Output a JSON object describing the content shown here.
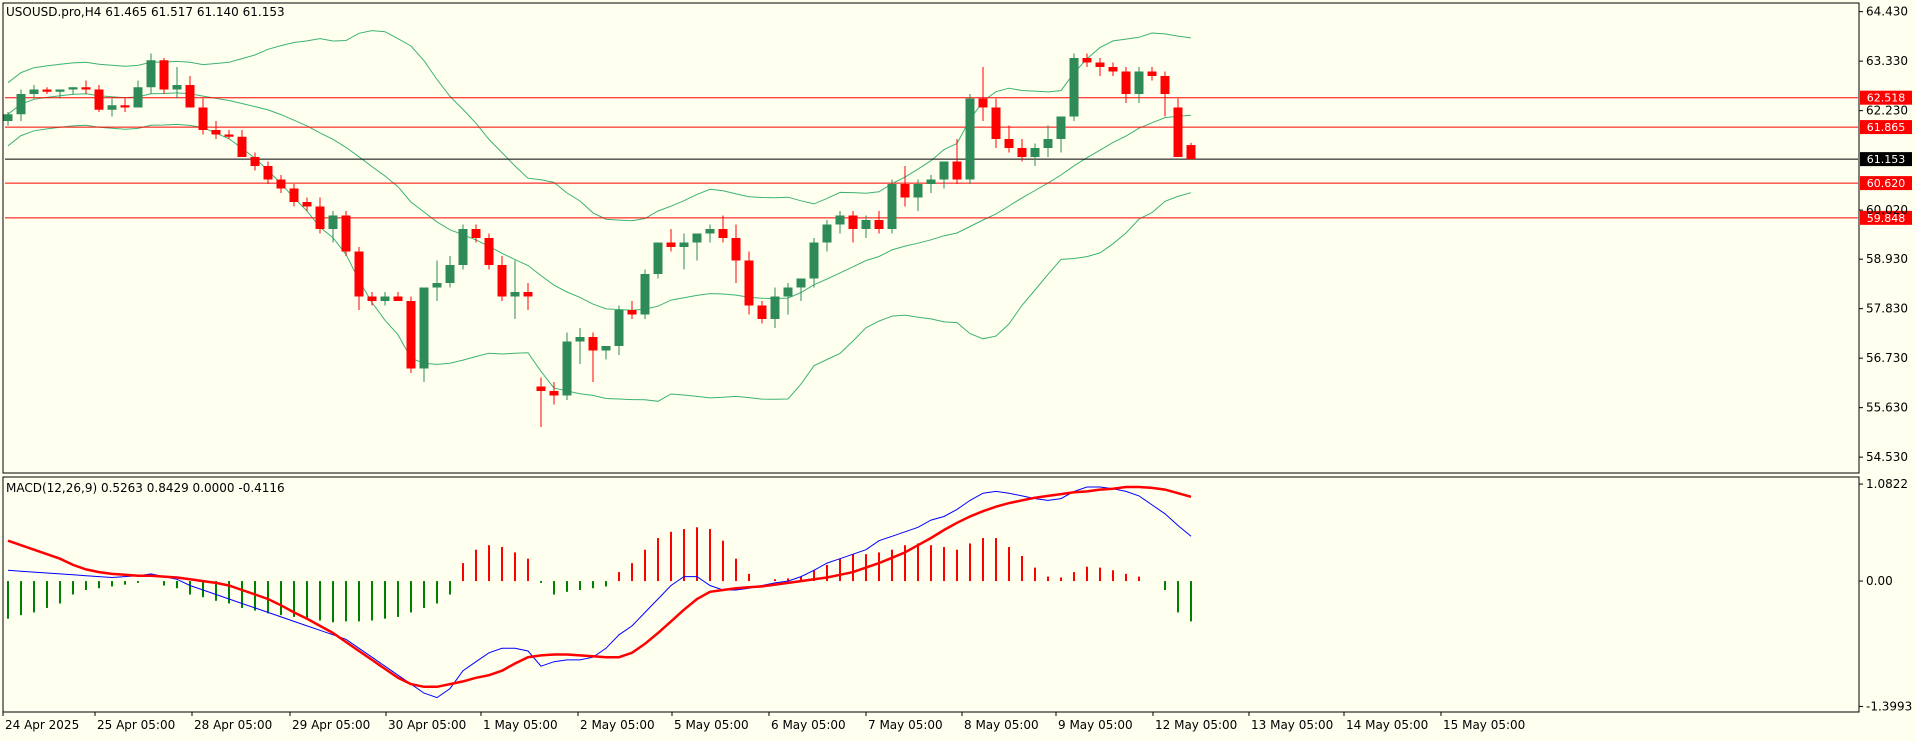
{
  "header": {
    "symbol_info": "USOUSD.pro,H4  61.465 61.517 61.140 61.153",
    "macd_info": "MACD(12,26,9) 0.5263 0.8429 0.0000 -0.4116"
  },
  "colors": {
    "background": "#fffff0",
    "bull": "#2e8b57",
    "bear": "#ff0000",
    "bands": "#3cb371",
    "level_line": "#ff0000",
    "current_line": "#000000",
    "macd_main": "#0000ff",
    "macd_signal": "#ff0000",
    "hist_pos": "#ff0000",
    "hist_neg": "#008000"
  },
  "chart_data": [
    {
      "type": "candlestick",
      "title": "USOUSD.pro,H4",
      "ohlc_last": {
        "open": 61.465,
        "high": 61.517,
        "low": 61.14,
        "close": 61.153
      },
      "ylim": [
        54.2,
        64.6
      ],
      "y_ticks": [
        "64.430",
        "63.330",
        "62.230",
        "60.020",
        "58.930",
        "57.830",
        "56.730",
        "55.630",
        "54.530"
      ],
      "x_ticks": [
        "24 Apr 2025",
        "25 Apr 05:00",
        "28 Apr 05:00",
        "29 Apr 05:00",
        "30 Apr 05:00",
        "1 May 05:00",
        "2 May 05:00",
        "5 May 05:00",
        "6 May 05:00",
        "7 May 05:00",
        "8 May 05:00",
        "9 May 05:00",
        "12 May 05:00",
        "13 May 05:00",
        "14 May 05:00",
        "15 May 05:00"
      ],
      "levels": [
        {
          "label": "62.518",
          "value": 62.518
        },
        {
          "label": "61.865",
          "value": 61.865
        },
        {
          "label": "60.620",
          "value": 60.62
        },
        {
          "label": "59.848",
          "value": 59.848
        }
      ],
      "current_price": {
        "label": "61.153",
        "value": 61.153
      },
      "candles": [
        [
          62.0,
          62.2,
          61.9,
          62.15
        ],
        [
          62.15,
          62.7,
          62.0,
          62.6
        ],
        [
          62.6,
          62.8,
          62.5,
          62.7
        ],
        [
          62.7,
          62.75,
          62.6,
          62.65
        ],
        [
          62.65,
          62.7,
          62.5,
          62.7
        ],
        [
          62.7,
          62.75,
          62.6,
          62.75
        ],
        [
          62.75,
          62.9,
          62.6,
          62.7
        ],
        [
          62.7,
          62.8,
          62.2,
          62.25
        ],
        [
          62.25,
          62.5,
          62.1,
          62.35
        ],
        [
          62.35,
          62.5,
          62.2,
          62.3
        ],
        [
          62.3,
          62.9,
          62.3,
          62.75
        ],
        [
          62.75,
          63.5,
          62.6,
          63.35
        ],
        [
          63.35,
          63.4,
          62.6,
          62.7
        ],
        [
          62.7,
          63.2,
          62.5,
          62.8
        ],
        [
          62.8,
          63.0,
          62.3,
          62.3
        ],
        [
          62.3,
          62.5,
          61.7,
          61.8
        ],
        [
          61.8,
          62.0,
          61.6,
          61.7
        ],
        [
          61.7,
          61.8,
          61.6,
          61.65
        ],
        [
          61.65,
          61.8,
          61.2,
          61.2
        ],
        [
          61.2,
          61.3,
          60.9,
          61.0
        ],
        [
          61.0,
          61.1,
          60.6,
          60.7
        ],
        [
          60.7,
          60.8,
          60.4,
          60.5
        ],
        [
          60.5,
          60.6,
          60.1,
          60.2
        ],
        [
          60.2,
          60.3,
          60.0,
          60.1
        ],
        [
          60.1,
          60.3,
          59.5,
          59.6
        ],
        [
          59.6,
          60.0,
          59.3,
          59.9
        ],
        [
          59.9,
          60.0,
          59.0,
          59.1
        ],
        [
          59.1,
          59.2,
          57.8,
          58.1
        ],
        [
          58.1,
          58.2,
          57.9,
          58.0
        ],
        [
          58.0,
          58.2,
          57.9,
          58.1
        ],
        [
          58.1,
          58.2,
          58.0,
          58.0
        ],
        [
          58.0,
          58.1,
          56.4,
          56.5
        ],
        [
          56.5,
          58.3,
          56.2,
          58.3
        ],
        [
          58.3,
          58.9,
          58.0,
          58.4
        ],
        [
          58.4,
          59.0,
          58.3,
          58.8
        ],
        [
          58.8,
          59.7,
          58.7,
          59.6
        ],
        [
          59.6,
          59.7,
          59.3,
          59.4
        ],
        [
          59.4,
          59.5,
          58.7,
          58.8
        ],
        [
          58.8,
          59.0,
          58.0,
          58.1
        ],
        [
          58.1,
          58.9,
          57.6,
          58.2
        ],
        [
          58.2,
          58.4,
          57.8,
          58.1
        ],
        [
          56.1,
          56.3,
          55.2,
          56.0
        ],
        [
          56.0,
          56.2,
          55.7,
          55.9
        ],
        [
          55.9,
          57.3,
          55.8,
          57.1
        ],
        [
          57.1,
          57.4,
          56.6,
          57.2
        ],
        [
          57.2,
          57.3,
          56.2,
          56.9
        ],
        [
          56.9,
          57.0,
          56.7,
          57.0
        ],
        [
          57.0,
          57.9,
          56.8,
          57.8
        ],
        [
          57.8,
          58.0,
          57.6,
          57.7
        ],
        [
          57.7,
          58.7,
          57.6,
          58.6
        ],
        [
          58.6,
          59.3,
          58.5,
          59.3
        ],
        [
          59.3,
          59.6,
          59.1,
          59.2
        ],
        [
          59.2,
          59.5,
          58.7,
          59.3
        ],
        [
          59.3,
          59.5,
          58.9,
          59.5
        ],
        [
          59.5,
          59.7,
          59.3,
          59.6
        ],
        [
          59.6,
          59.9,
          59.3,
          59.4
        ],
        [
          59.4,
          59.7,
          58.4,
          58.9
        ],
        [
          58.9,
          59.1,
          57.7,
          57.9
        ],
        [
          57.9,
          58.0,
          57.5,
          57.6
        ],
        [
          57.6,
          58.3,
          57.4,
          58.1
        ],
        [
          58.1,
          58.4,
          57.7,
          58.3
        ],
        [
          58.3,
          58.5,
          58.0,
          58.5
        ],
        [
          58.5,
          59.4,
          58.3,
          59.3
        ],
        [
          59.3,
          59.8,
          59.1,
          59.7
        ],
        [
          59.7,
          60.0,
          59.5,
          59.9
        ],
        [
          59.9,
          60.0,
          59.3,
          59.6
        ],
        [
          59.6,
          59.9,
          59.4,
          59.8
        ],
        [
          59.8,
          60.0,
          59.5,
          59.6
        ],
        [
          59.6,
          60.7,
          59.5,
          60.6
        ],
        [
          60.6,
          61.0,
          60.1,
          60.3
        ],
        [
          60.3,
          60.7,
          60.0,
          60.6
        ],
        [
          60.6,
          60.8,
          60.4,
          60.7
        ],
        [
          60.7,
          61.1,
          60.5,
          61.1
        ],
        [
          61.1,
          61.6,
          60.6,
          60.7
        ],
        [
          60.7,
          62.6,
          60.6,
          62.5
        ],
        [
          62.5,
          63.2,
          62.0,
          62.3
        ],
        [
          62.3,
          62.5,
          61.4,
          61.6
        ],
        [
          61.6,
          61.9,
          61.3,
          61.4
        ],
        [
          61.4,
          61.6,
          61.1,
          61.2
        ],
        [
          61.2,
          61.5,
          61.0,
          61.4
        ],
        [
          61.4,
          61.9,
          61.2,
          61.6
        ],
        [
          61.6,
          62.1,
          61.3,
          62.1
        ],
        [
          62.1,
          63.5,
          62.0,
          63.4
        ],
        [
          63.4,
          63.5,
          63.2,
          63.3
        ],
        [
          63.3,
          63.4,
          63.0,
          63.2
        ],
        [
          63.2,
          63.3,
          63.0,
          63.1
        ],
        [
          63.1,
          63.2,
          62.4,
          62.6
        ],
        [
          62.6,
          63.2,
          62.4,
          63.1
        ],
        [
          63.1,
          63.2,
          62.9,
          63.0
        ],
        [
          63.0,
          63.1,
          62.1,
          62.6
        ],
        [
          62.3,
          62.5,
          61.2,
          61.2
        ],
        [
          61.465,
          61.517,
          61.14,
          61.153
        ]
      ]
    },
    {
      "type": "macd",
      "title": "MACD(12,26,9)",
      "values": {
        "main": 0.5263,
        "signal": 0.8429,
        "third": 0.0,
        "fourth": -0.4116
      },
      "ylim": [
        -1.45,
        1.15
      ],
      "y_ticks": [
        "1.0822",
        "0.00",
        "-1.3993"
      ],
      "main": [
        0.12,
        0.11,
        0.1,
        0.09,
        0.08,
        0.07,
        0.06,
        0.05,
        0.04,
        0.05,
        0.06,
        0.08,
        0.05,
        0.02,
        -0.05,
        -0.1,
        -0.15,
        -0.2,
        -0.25,
        -0.3,
        -0.35,
        -0.4,
        -0.45,
        -0.5,
        -0.55,
        -0.6,
        -0.65,
        -0.75,
        -0.85,
        -0.95,
        -1.05,
        -1.15,
        -1.25,
        -1.3,
        -1.2,
        -1.0,
        -0.9,
        -0.8,
        -0.75,
        -0.75,
        -0.78,
        -0.95,
        -0.9,
        -0.88,
        -0.88,
        -0.85,
        -0.75,
        -0.6,
        -0.5,
        -0.35,
        -0.2,
        -0.05,
        0.05,
        0.05,
        -0.05,
        -0.1,
        -0.1,
        -0.08,
        -0.05,
        -0.02,
        0.0,
        0.05,
        0.12,
        0.2,
        0.25,
        0.3,
        0.35,
        0.45,
        0.5,
        0.55,
        0.6,
        0.68,
        0.72,
        0.8,
        0.9,
        0.98,
        1.0,
        0.98,
        0.95,
        0.92,
        0.9,
        0.92,
        1.0,
        1.05,
        1.05,
        1.03,
        1.0,
        0.95,
        0.85,
        0.75,
        0.62,
        0.5
      ],
      "signal": [
        0.45,
        0.4,
        0.35,
        0.3,
        0.25,
        0.18,
        0.13,
        0.1,
        0.08,
        0.07,
        0.06,
        0.06,
        0.05,
        0.04,
        0.02,
        0.0,
        -0.02,
        -0.05,
        -0.1,
        -0.15,
        -0.2,
        -0.27,
        -0.35,
        -0.42,
        -0.5,
        -0.58,
        -0.68,
        -0.78,
        -0.88,
        -0.98,
        -1.08,
        -1.15,
        -1.18,
        -1.18,
        -1.15,
        -1.12,
        -1.08,
        -1.05,
        -1.0,
        -0.92,
        -0.85,
        -0.83,
        -0.82,
        -0.82,
        -0.83,
        -0.84,
        -0.85,
        -0.85,
        -0.8,
        -0.7,
        -0.58,
        -0.45,
        -0.32,
        -0.2,
        -0.12,
        -0.1,
        -0.08,
        -0.07,
        -0.06,
        -0.04,
        -0.02,
        0.0,
        0.02,
        0.04,
        0.07,
        0.1,
        0.15,
        0.2,
        0.26,
        0.32,
        0.4,
        0.48,
        0.57,
        0.65,
        0.72,
        0.78,
        0.83,
        0.87,
        0.9,
        0.93,
        0.95,
        0.97,
        0.99,
        1.0,
        1.02,
        1.03,
        1.05,
        1.05,
        1.04,
        1.02,
        0.98,
        0.94
      ],
      "histogram": [
        -0.42,
        -0.38,
        -0.35,
        -0.3,
        -0.25,
        -0.15,
        -0.1,
        -0.08,
        -0.06,
        -0.04,
        -0.02,
        0.0,
        -0.05,
        -0.08,
        -0.15,
        -0.18,
        -0.22,
        -0.25,
        -0.3,
        -0.33,
        -0.36,
        -0.38,
        -0.4,
        -0.42,
        -0.44,
        -0.46,
        -0.45,
        -0.45,
        -0.44,
        -0.42,
        -0.4,
        -0.35,
        -0.3,
        -0.25,
        -0.15,
        0.2,
        0.35,
        0.4,
        0.38,
        0.32,
        0.25,
        -0.02,
        -0.15,
        -0.12,
        -0.1,
        -0.08,
        -0.06,
        0.1,
        0.2,
        0.35,
        0.48,
        0.55,
        0.58,
        0.6,
        0.58,
        0.45,
        0.25,
        0.08,
        0.0,
        0.02,
        0.03,
        0.05,
        0.12,
        0.18,
        0.25,
        0.3,
        0.3,
        0.32,
        0.35,
        0.4,
        0.42,
        0.4,
        0.38,
        0.35,
        0.42,
        0.48,
        0.48,
        0.38,
        0.28,
        0.15,
        0.05,
        0.04,
        0.1,
        0.16,
        0.15,
        0.12,
        0.08,
        0.05,
        0.0,
        -0.1,
        -0.35,
        -0.45
      ]
    }
  ]
}
